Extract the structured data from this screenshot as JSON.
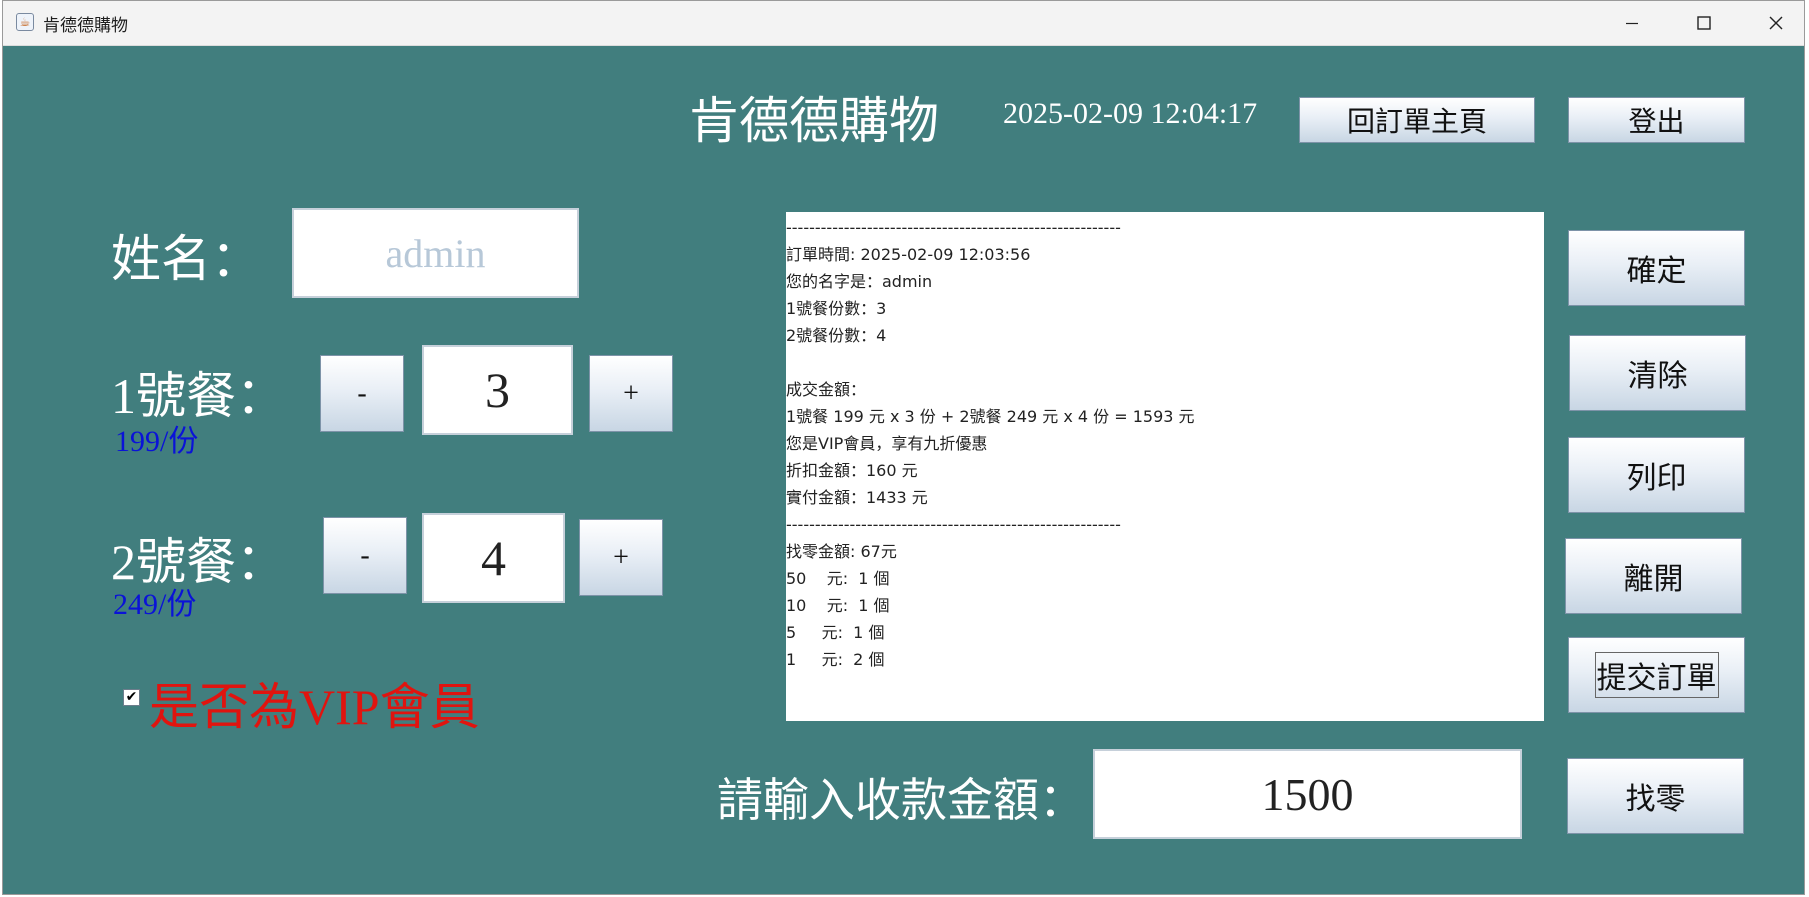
{
  "window": {
    "title": "肯德德購物",
    "controls": {
      "minimize": "–",
      "maximize": "☐",
      "close": "✕"
    }
  },
  "header": {
    "app_title": "肯德德購物",
    "datetime": "2025-02-09 12:04:17",
    "back_button": "回訂單主頁",
    "logout_button": "登出"
  },
  "form": {
    "name_label": "姓名：",
    "name_value": "admin",
    "meal1": {
      "label": "1號餐：",
      "price": "199/份",
      "qty": "3",
      "minus": "-",
      "plus": "+"
    },
    "meal2": {
      "label": "2號餐：",
      "price": "249/份",
      "qty": "4",
      "minus": "-",
      "plus": "+"
    },
    "vip_checked": true,
    "vip_check_glyph": "✔",
    "vip_label": "是否為VIP會員"
  },
  "receipt": {
    "lines": [
      "----------------------------------------------------------",
      "訂單時間: 2025-02-09 12:03:56",
      "您的名字是：admin",
      "1號餐份數：3",
      "2號餐份數：4",
      "",
      "成交金額：",
      "1號餐 199 元 x 3 份 + 2號餐 249 元 x 4 份 = 1593 元",
      "您是VIP會員，享有九折優惠",
      "折扣金額：160 元",
      "實付金額：1433 元",
      "----------------------------------------------------------",
      "找零金額: 67元",
      "50    元:  1 個",
      "10    元:  1 個",
      "5     元:  1 個",
      "1     元:  2 個"
    ]
  },
  "actions": {
    "confirm": "確定",
    "clear": "清除",
    "print": "列印",
    "leave": "離開",
    "submit": "提交訂單",
    "change": "找零"
  },
  "payment": {
    "label": "請輸入收款金額：",
    "amount": "1500"
  },
  "colors": {
    "background": "#417e7e",
    "price_text": "#0a12d8",
    "vip_text": "#e0140f"
  }
}
